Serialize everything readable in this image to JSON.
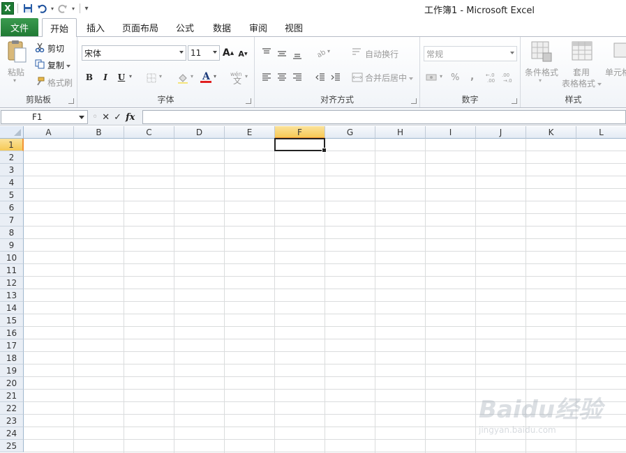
{
  "window": {
    "title": "工作簿1 - Microsoft Excel"
  },
  "tabs": {
    "file": "文件",
    "items": [
      "开始",
      "插入",
      "页面布局",
      "公式",
      "数据",
      "审阅",
      "视图"
    ],
    "active": "开始"
  },
  "ribbon": {
    "clipboard": {
      "paste": "粘贴",
      "cut": "剪切",
      "copy": "复制",
      "format_painter": "格式刷",
      "label": "剪贴板"
    },
    "font": {
      "font_name": "宋体",
      "font_size": "11",
      "bold": "B",
      "italic": "I",
      "underline": "U",
      "label": "字体",
      "font_color": "#e02020"
    },
    "alignment": {
      "wrap_text": "自动换行",
      "merge_center": "合并后居中",
      "label": "对齐方式"
    },
    "number": {
      "format": "常规",
      "percent": "%",
      "comma": ",",
      "label": "数字"
    },
    "styles": {
      "conditional_format": "条件格式",
      "table_format_1": "套用",
      "table_format_2": "表格格式",
      "cell_styles": "单元格",
      "label": "样式"
    }
  },
  "formula_bar": {
    "name_box": "F1",
    "fx": "fx",
    "formula": ""
  },
  "sheet": {
    "columns": [
      "A",
      "B",
      "C",
      "D",
      "E",
      "F",
      "G",
      "H",
      "I",
      "J",
      "K",
      "L"
    ],
    "rows": [
      "1",
      "2",
      "3",
      "4",
      "5",
      "6",
      "7",
      "8",
      "9",
      "10",
      "11",
      "12",
      "13",
      "14",
      "15",
      "16",
      "17",
      "18",
      "19",
      "20",
      "21",
      "22",
      "23",
      "24",
      "25"
    ],
    "selected_cell": "F1",
    "selected_column": "F",
    "selected_row": "1"
  },
  "watermark": {
    "logo": "Baidu经验",
    "url": "jingyan.baidu.com"
  },
  "colors": {
    "file_tab": "#217a35",
    "selection_header": "#f6c955",
    "grid_line": "#dadcdd"
  }
}
